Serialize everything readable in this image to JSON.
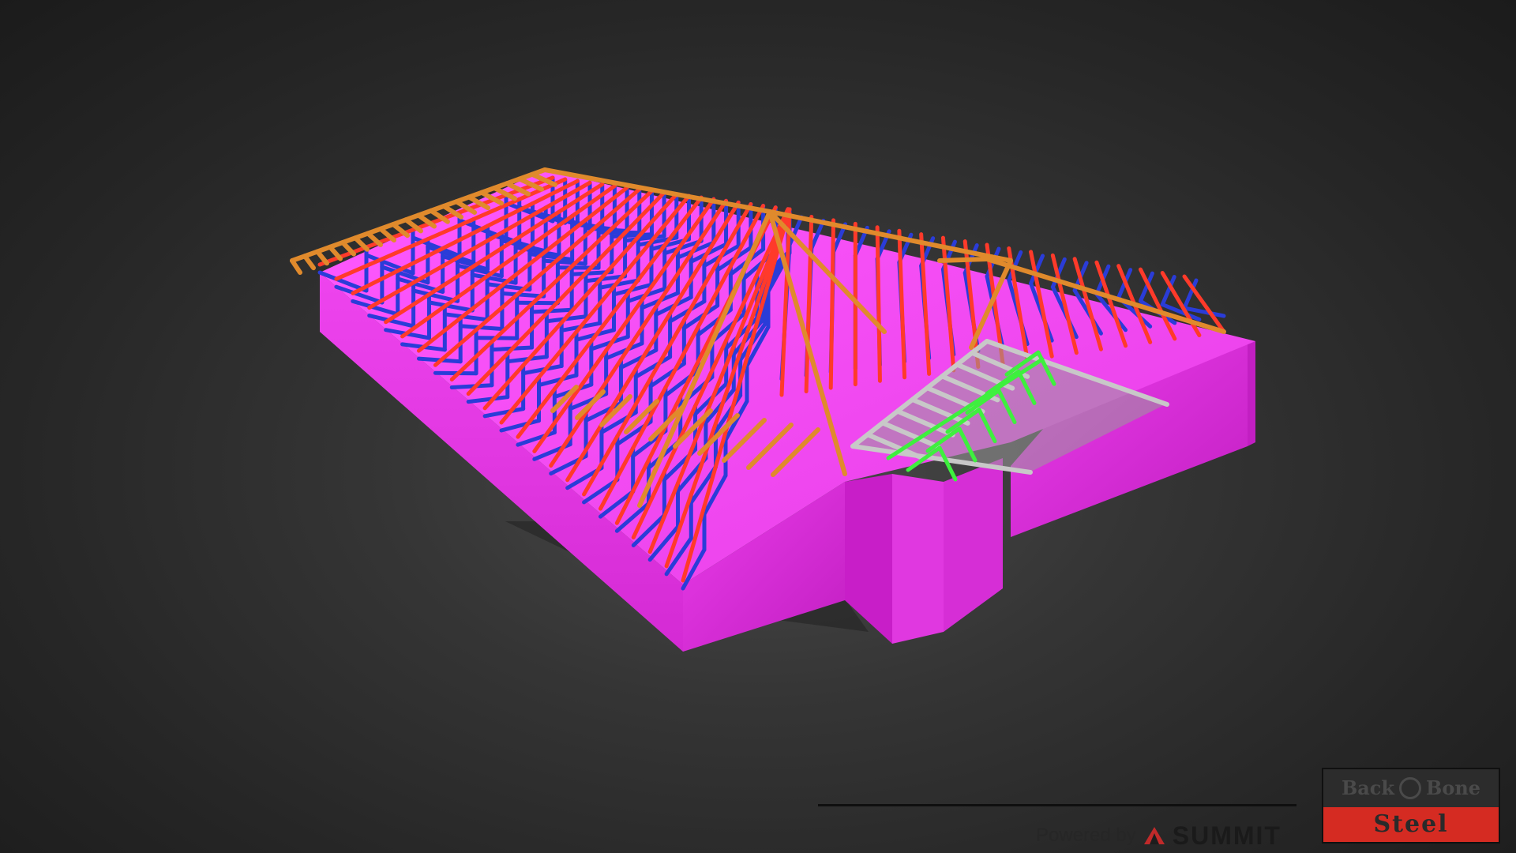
{
  "viewer": {
    "model_colors": {
      "walls": "#e632e6",
      "top_chords": "#ff3a2a",
      "hip_rafters": "#e08a2c",
      "webs": "#2a3cd8",
      "gable_webs": "#3ef03e",
      "steel": "#b4b4b4"
    }
  },
  "footer": {
    "powered_by": "Powered by",
    "brand": "SUMMIT",
    "brand_icon": "summit-mountain-icon"
  },
  "logo": {
    "line1_a": "Back",
    "line1_b": "Bone",
    "line2": "Steel"
  }
}
